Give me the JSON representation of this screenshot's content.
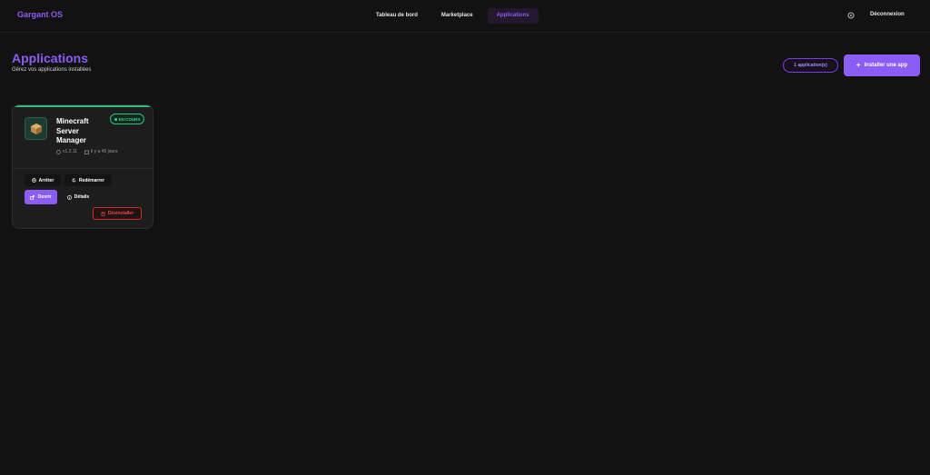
{
  "brand": "Gargant OS",
  "nav": {
    "items": [
      {
        "label": "Tableau de bord"
      },
      {
        "label": "Marketplace"
      },
      {
        "label": "Applications"
      }
    ],
    "active": "Applications",
    "logout": "Déconnexion"
  },
  "header": {
    "title": "Applications",
    "subtitle": "Gérez vos applications installées",
    "count_badge": "1 application(s)",
    "install_label": "Installer une app"
  },
  "app_card": {
    "name": "Minecraft Server Manager",
    "status": "EN COURS",
    "version": "v1.2.11",
    "age": "il y a 45 jours",
    "actions": {
      "stop": "Arrêter",
      "restart": "Redémarrer",
      "open": "Ouvrir",
      "details": "Détails",
      "uninstall": "Désinstaller"
    }
  },
  "colors": {
    "accent": "#8b5cf6",
    "running": "#2dbf80",
    "danger": "#ef4444",
    "background": "#121212"
  }
}
